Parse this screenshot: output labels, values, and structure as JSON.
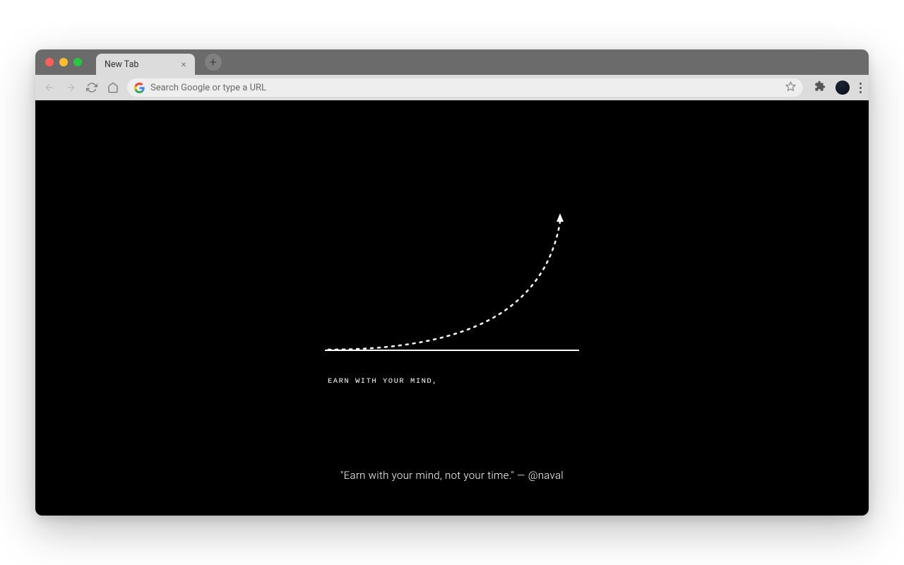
{
  "tab": {
    "title": "New Tab"
  },
  "addressbar": {
    "placeholder": "Search Google or type a URL"
  },
  "content": {
    "caption": "EARN WITH YOUR MIND,",
    "quote": "\"Earn with your mind, not your time.\" — @naval"
  }
}
